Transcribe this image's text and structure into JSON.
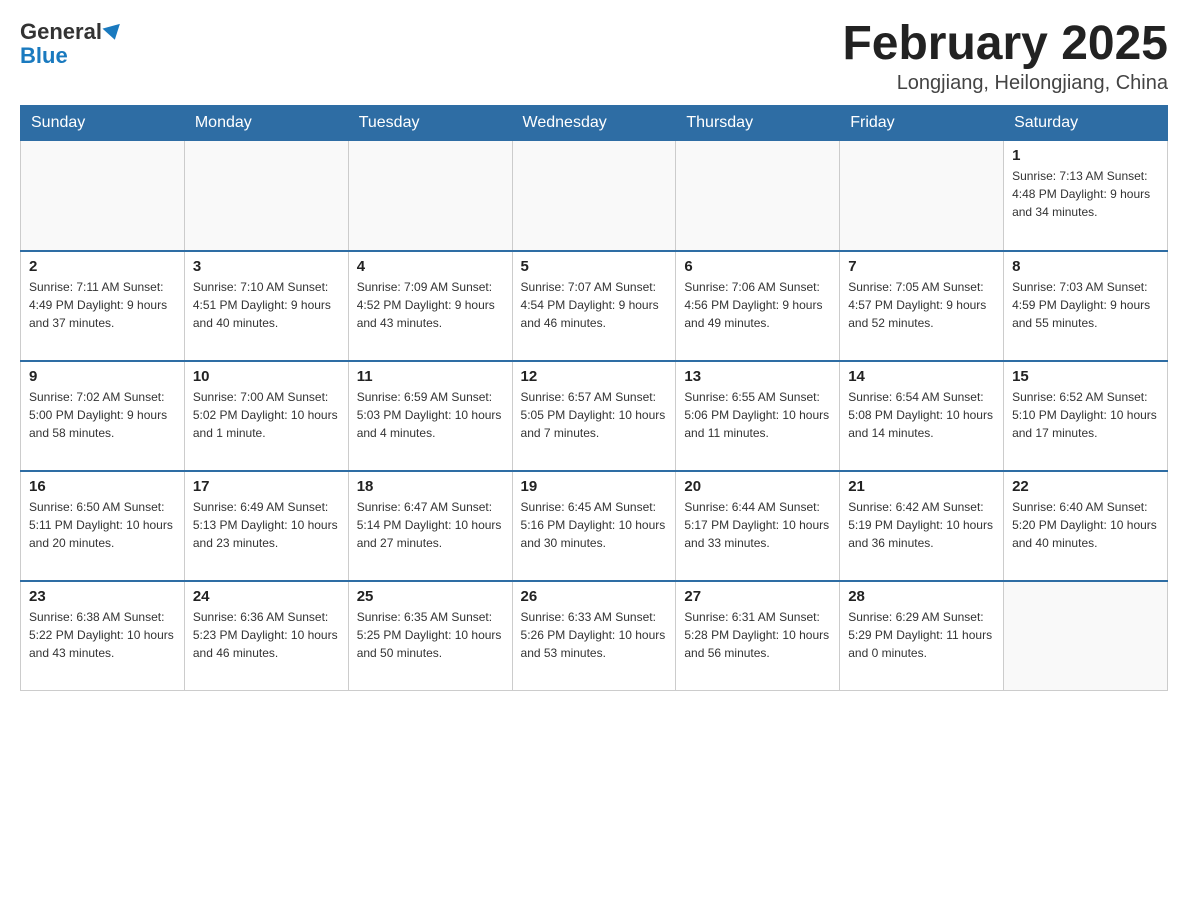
{
  "logo": {
    "general": "General",
    "blue": "Blue"
  },
  "title": {
    "month_year": "February 2025",
    "location": "Longjiang, Heilongjiang, China"
  },
  "weekdays": [
    "Sunday",
    "Monday",
    "Tuesday",
    "Wednesday",
    "Thursday",
    "Friday",
    "Saturday"
  ],
  "weeks": [
    [
      {
        "day": "",
        "info": ""
      },
      {
        "day": "",
        "info": ""
      },
      {
        "day": "",
        "info": ""
      },
      {
        "day": "",
        "info": ""
      },
      {
        "day": "",
        "info": ""
      },
      {
        "day": "",
        "info": ""
      },
      {
        "day": "1",
        "info": "Sunrise: 7:13 AM\nSunset: 4:48 PM\nDaylight: 9 hours and 34 minutes."
      }
    ],
    [
      {
        "day": "2",
        "info": "Sunrise: 7:11 AM\nSunset: 4:49 PM\nDaylight: 9 hours and 37 minutes."
      },
      {
        "day": "3",
        "info": "Sunrise: 7:10 AM\nSunset: 4:51 PM\nDaylight: 9 hours and 40 minutes."
      },
      {
        "day": "4",
        "info": "Sunrise: 7:09 AM\nSunset: 4:52 PM\nDaylight: 9 hours and 43 minutes."
      },
      {
        "day": "5",
        "info": "Sunrise: 7:07 AM\nSunset: 4:54 PM\nDaylight: 9 hours and 46 minutes."
      },
      {
        "day": "6",
        "info": "Sunrise: 7:06 AM\nSunset: 4:56 PM\nDaylight: 9 hours and 49 minutes."
      },
      {
        "day": "7",
        "info": "Sunrise: 7:05 AM\nSunset: 4:57 PM\nDaylight: 9 hours and 52 minutes."
      },
      {
        "day": "8",
        "info": "Sunrise: 7:03 AM\nSunset: 4:59 PM\nDaylight: 9 hours and 55 minutes."
      }
    ],
    [
      {
        "day": "9",
        "info": "Sunrise: 7:02 AM\nSunset: 5:00 PM\nDaylight: 9 hours and 58 minutes."
      },
      {
        "day": "10",
        "info": "Sunrise: 7:00 AM\nSunset: 5:02 PM\nDaylight: 10 hours and 1 minute."
      },
      {
        "day": "11",
        "info": "Sunrise: 6:59 AM\nSunset: 5:03 PM\nDaylight: 10 hours and 4 minutes."
      },
      {
        "day": "12",
        "info": "Sunrise: 6:57 AM\nSunset: 5:05 PM\nDaylight: 10 hours and 7 minutes."
      },
      {
        "day": "13",
        "info": "Sunrise: 6:55 AM\nSunset: 5:06 PM\nDaylight: 10 hours and 11 minutes."
      },
      {
        "day": "14",
        "info": "Sunrise: 6:54 AM\nSunset: 5:08 PM\nDaylight: 10 hours and 14 minutes."
      },
      {
        "day": "15",
        "info": "Sunrise: 6:52 AM\nSunset: 5:10 PM\nDaylight: 10 hours and 17 minutes."
      }
    ],
    [
      {
        "day": "16",
        "info": "Sunrise: 6:50 AM\nSunset: 5:11 PM\nDaylight: 10 hours and 20 minutes."
      },
      {
        "day": "17",
        "info": "Sunrise: 6:49 AM\nSunset: 5:13 PM\nDaylight: 10 hours and 23 minutes."
      },
      {
        "day": "18",
        "info": "Sunrise: 6:47 AM\nSunset: 5:14 PM\nDaylight: 10 hours and 27 minutes."
      },
      {
        "day": "19",
        "info": "Sunrise: 6:45 AM\nSunset: 5:16 PM\nDaylight: 10 hours and 30 minutes."
      },
      {
        "day": "20",
        "info": "Sunrise: 6:44 AM\nSunset: 5:17 PM\nDaylight: 10 hours and 33 minutes."
      },
      {
        "day": "21",
        "info": "Sunrise: 6:42 AM\nSunset: 5:19 PM\nDaylight: 10 hours and 36 minutes."
      },
      {
        "day": "22",
        "info": "Sunrise: 6:40 AM\nSunset: 5:20 PM\nDaylight: 10 hours and 40 minutes."
      }
    ],
    [
      {
        "day": "23",
        "info": "Sunrise: 6:38 AM\nSunset: 5:22 PM\nDaylight: 10 hours and 43 minutes."
      },
      {
        "day": "24",
        "info": "Sunrise: 6:36 AM\nSunset: 5:23 PM\nDaylight: 10 hours and 46 minutes."
      },
      {
        "day": "25",
        "info": "Sunrise: 6:35 AM\nSunset: 5:25 PM\nDaylight: 10 hours and 50 minutes."
      },
      {
        "day": "26",
        "info": "Sunrise: 6:33 AM\nSunset: 5:26 PM\nDaylight: 10 hours and 53 minutes."
      },
      {
        "day": "27",
        "info": "Sunrise: 6:31 AM\nSunset: 5:28 PM\nDaylight: 10 hours and 56 minutes."
      },
      {
        "day": "28",
        "info": "Sunrise: 6:29 AM\nSunset: 5:29 PM\nDaylight: 11 hours and 0 minutes."
      },
      {
        "day": "",
        "info": ""
      }
    ]
  ]
}
